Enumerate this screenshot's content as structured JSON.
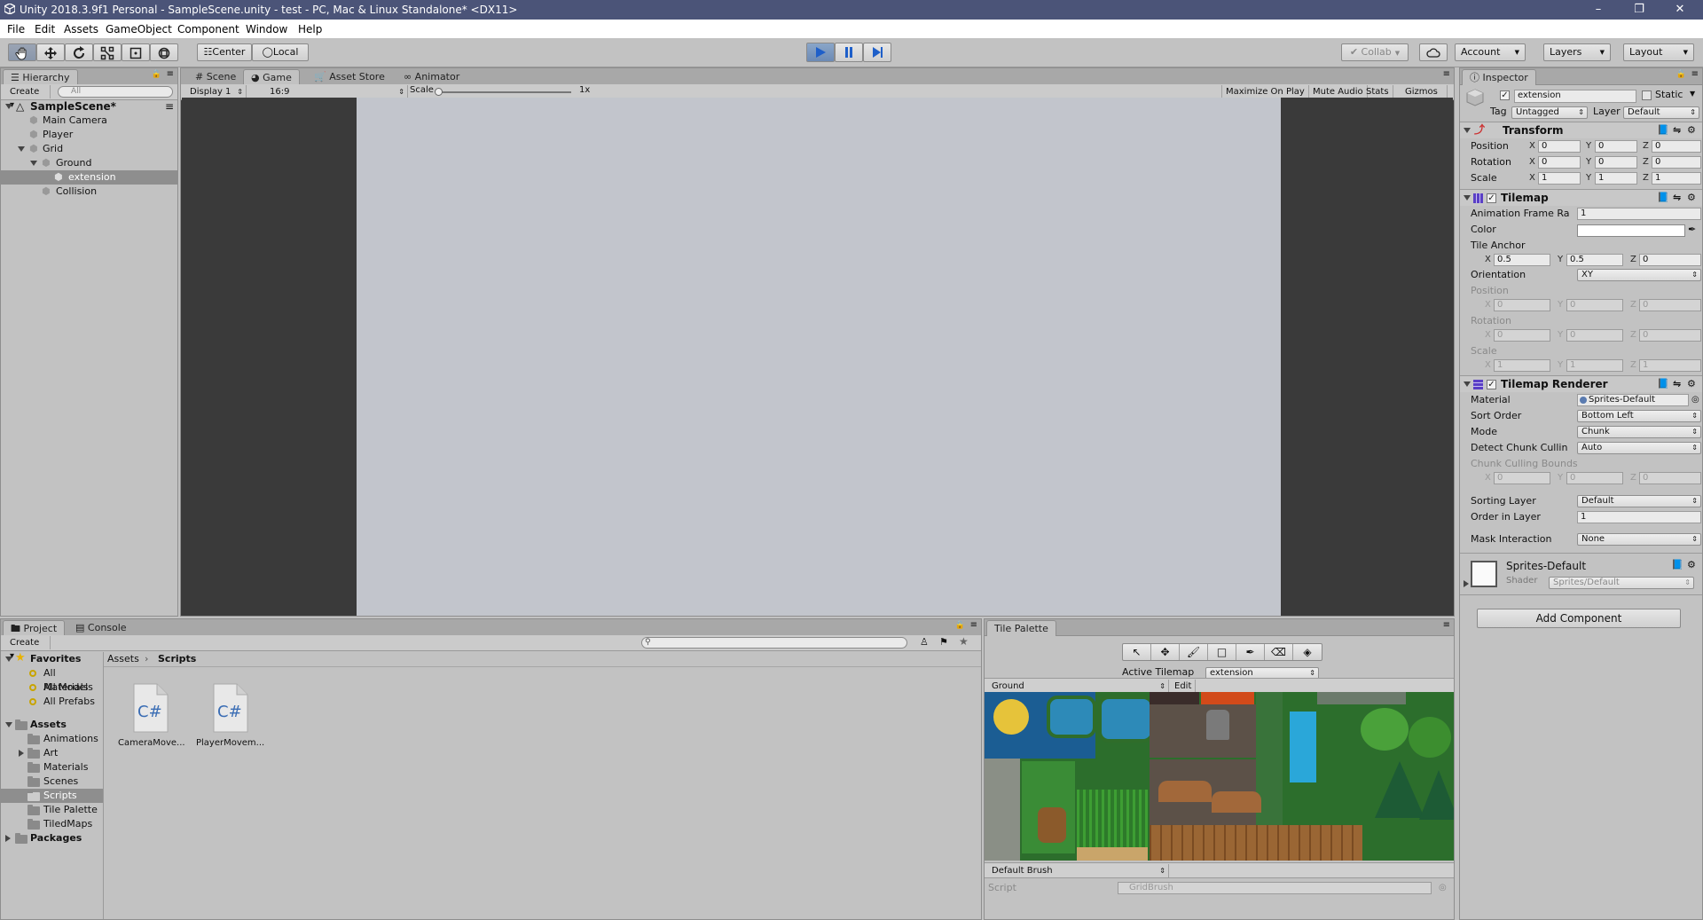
{
  "window": {
    "title": "Unity 2018.3.9f1 Personal - SampleScene.unity - test - PC, Mac & Linux Standalone* <DX11>",
    "controls": [
      "–",
      "❐",
      "✕"
    ]
  },
  "menu": [
    "File",
    "Edit",
    "Assets",
    "GameObject",
    "Component",
    "Window",
    "Help"
  ],
  "toolbar": {
    "pivot": "Center",
    "space": "Local",
    "collab": "Collab",
    "account": "Account",
    "layers": "Layers",
    "layout": "Layout",
    "playing": true,
    "colors": {
      "play_active": "#4a7fd1"
    }
  },
  "hierarchy": {
    "tab": "Hierarchy",
    "create": "Create",
    "search_placeholder": "All",
    "scene": "SampleScene*",
    "items": [
      "Main Camera",
      "Player",
      "Grid",
      "Ground",
      "extension",
      "Collision"
    ]
  },
  "center_tabs": [
    "Scene",
    "Game",
    "Asset Store",
    "Animator"
  ],
  "game": {
    "display": "Display 1",
    "aspect": "16:9",
    "scale_label": "Scale",
    "scale_value": "1x",
    "buttons": [
      "Maximize On Play",
      "Mute Audio",
      "Stats",
      "Gizmos"
    ]
  },
  "inspector": {
    "tab": "Inspector",
    "object_name": "extension",
    "static_label": "Static",
    "tag_label": "Tag",
    "tag_value": "Untagged",
    "layer_label": "Layer",
    "layer_value": "Default",
    "transform": {
      "title": "Transform",
      "position_label": "Position",
      "rotation_label": "Rotation",
      "scale_label": "Scale",
      "position": [
        "0",
        "0",
        "0"
      ],
      "rotation": [
        "0",
        "0",
        "0"
      ],
      "scale": [
        "1",
        "1",
        "1"
      ]
    },
    "tilemap": {
      "title": "Tilemap",
      "anim_label": "Animation Frame Ra",
      "anim_value": "1",
      "color_label": "Color",
      "tile_anchor_label": "Tile Anchor",
      "tile_anchor": [
        "0.5",
        "0.5",
        "0"
      ],
      "orientation_label": "Orientation",
      "orientation_value": "XY",
      "position_label": "Position",
      "position": [
        "0",
        "0",
        "0"
      ],
      "rotation_label": "Rotation",
      "rotation": [
        "0",
        "0",
        "0"
      ],
      "scale_label": "Scale",
      "scale": [
        "1",
        "1",
        "1"
      ]
    },
    "renderer": {
      "title": "Tilemap Renderer",
      "material_label": "Material",
      "material_value": "Sprites-Default",
      "sort_order_label": "Sort Order",
      "sort_order_value": "Bottom Left",
      "mode_label": "Mode",
      "mode_value": "Chunk",
      "culling_label": "Detect Chunk Cullin",
      "culling_value": "Auto",
      "bounds_label": "Chunk Culling Bounds",
      "bounds": [
        "0",
        "0",
        "0"
      ],
      "sorting_layer_label": "Sorting Layer",
      "sorting_layer_value": "Default",
      "order_label": "Order in Layer",
      "order_value": "1",
      "mask_label": "Mask Interaction",
      "mask_value": "None"
    },
    "material_block": {
      "name": "Sprites-Default",
      "shader_label": "Shader",
      "shader_value": "Sprites/Default"
    },
    "add_component": "Add Component"
  },
  "project": {
    "tabs": [
      "Project",
      "Console"
    ],
    "create": "Create",
    "breadcrumb": [
      "Assets",
      "Scripts"
    ],
    "favorites_label": "Favorites",
    "favorites": [
      "All Materials",
      "All Models",
      "All Prefabs"
    ],
    "assets_label": "Assets",
    "folders": [
      "Animations",
      "Art",
      "Materials",
      "Scenes",
      "Scripts",
      "Tile Palette",
      "TiledMaps"
    ],
    "packages_label": "Packages",
    "files": [
      {
        "name": "CameraMove...",
        "icon": "C#"
      },
      {
        "name": "PlayerMovem...",
        "icon": "C#"
      }
    ]
  },
  "tile_palette": {
    "tab": "Tile Palette",
    "active_tilemap_label": "Active Tilemap",
    "active_tilemap_value": "extension",
    "palette_value": "Ground",
    "edit_label": "Edit",
    "brush_value": "Default Brush",
    "script_label": "Script",
    "script_value": "GridBrush"
  }
}
